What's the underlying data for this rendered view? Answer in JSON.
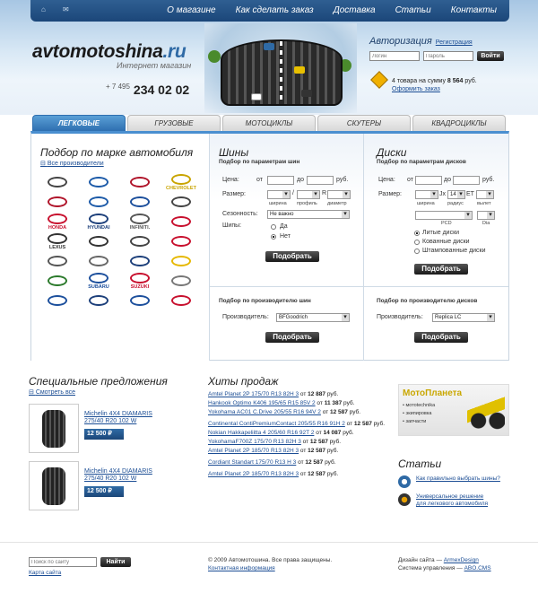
{
  "nav": {
    "items": [
      "О магазине",
      "Как сделать заказ",
      "Доставка",
      "Статьи",
      "Контакты"
    ]
  },
  "logo": {
    "name": "avtomotoshina",
    "tld": ".ru",
    "tagline": "Интернет магазин"
  },
  "phone": {
    "code": "+ 7 495",
    "number": "234 02 02"
  },
  "auth": {
    "title": "Авторизация",
    "register": "Регистрация",
    "login_placeholder": "Логин",
    "password_placeholder": "Пароль",
    "submit": "Войти"
  },
  "cart": {
    "text_pre": "4 товара на сумму",
    "sum": "8 564",
    "currency": "руб.",
    "order_link": "Оформить заказ"
  },
  "tabs": [
    "ЛЕГКОВЫЕ",
    "ГРУЗОВЫЕ",
    "МОТОЦИКЛЫ",
    "СКУТЕРЫ",
    "КВАДРОЦИКЛЫ"
  ],
  "brands": {
    "title": "Подбор по марке автомобиля",
    "all": "Все производители",
    "items": [
      {
        "label": "",
        "icon": "audi-logo",
        "color": "#444"
      },
      {
        "label": "",
        "icon": "bmw-logo",
        "color": "#1c5aa8"
      },
      {
        "label": "",
        "icon": "chery-logo",
        "color": "#b0142a"
      },
      {
        "label": "CHEVROLET",
        "icon": "chevrolet-logo",
        "color": "#c9a400"
      },
      {
        "label": "",
        "icon": "citroen-logo",
        "color": "#b0142a"
      },
      {
        "label": "",
        "icon": "daewoo-logo",
        "color": "#1c5aa8"
      },
      {
        "label": "",
        "icon": "ford-logo",
        "color": "#1c4f9c"
      },
      {
        "label": "",
        "icon": "infiniti-like-logo",
        "color": "#444"
      },
      {
        "label": "HONDA",
        "icon": "honda-logo",
        "color": "#c8102e"
      },
      {
        "label": "HYUNDAI",
        "icon": "hyundai-logo",
        "color": "#1c3f7a"
      },
      {
        "label": "INFINITI.",
        "icon": "infiniti-logo",
        "color": "#555"
      },
      {
        "label": "",
        "icon": "kia-logo",
        "color": "#c8102e"
      },
      {
        "label": "LEXUS",
        "icon": "lexus-logo",
        "color": "#333"
      },
      {
        "label": "",
        "icon": "mazda-logo",
        "color": "#333"
      },
      {
        "label": "",
        "icon": "mercedes-logo",
        "color": "#444"
      },
      {
        "label": "",
        "icon": "mitsubishi-logo",
        "color": "#c8102e"
      },
      {
        "label": "",
        "icon": "nissan-logo",
        "color": "#555"
      },
      {
        "label": "",
        "icon": "opel-logo",
        "color": "#666"
      },
      {
        "label": "",
        "icon": "peugeot-logo",
        "color": "#1c3f7a"
      },
      {
        "label": "",
        "icon": "renault-logo",
        "color": "#e6b800"
      },
      {
        "label": "",
        "icon": "skoda-logo",
        "color": "#2b7a2b"
      },
      {
        "label": "SUBARU",
        "icon": "subaru-logo",
        "color": "#1c4f9c"
      },
      {
        "label": "SUZUKI",
        "icon": "suzuki-logo",
        "color": "#c8102e"
      },
      {
        "label": "",
        "icon": "toyota-logo",
        "color": "#777"
      },
      {
        "label": "",
        "icon": "volkswagen-logo",
        "color": "#1c4f9c"
      },
      {
        "label": "",
        "icon": "volvo-logo",
        "color": "#1c3f7a"
      },
      {
        "label": "",
        "icon": "chevrolet-blue-logo",
        "color": "#1c4f9c"
      },
      {
        "label": "",
        "icon": "gaz-logo",
        "color": "#c8102e"
      }
    ]
  },
  "tires": {
    "title": "Шины",
    "sub": "Подбор по параметрам шин",
    "price_label": "Цена:",
    "from": "от",
    "to": "до",
    "currency": "руб.",
    "size_label": "Размер:",
    "slash": "/",
    "r": "R",
    "width": "ширина",
    "profile": "профиль",
    "diameter": "диаметр",
    "season_label": "Сезонность:",
    "season_value": "Не важно",
    "spikes_label": "Шипы:",
    "yes": "Да",
    "no": "Нет",
    "submit": "Подобрать",
    "maker_sub": "Подбор по производителю шин",
    "maker_label": "Производитель:",
    "maker_value": "BFGoodrich",
    "maker_submit": "Подобрать"
  },
  "discs": {
    "title": "Диски",
    "sub": "Подбор по параметрам дисков",
    "price_label": "Цена:",
    "from": "от",
    "to": "до",
    "currency": "руб.",
    "size_label": "Размер:",
    "jx": "Jx",
    "et": "ET",
    "width": "ширина",
    "radius": "радиус",
    "radius_value": "14",
    "offset": "вылет",
    "pcd": "PCD",
    "dia": "Dia",
    "opt1": "Литые диски",
    "opt2": "Кованные диски",
    "opt3": "Штампованные диски",
    "submit": "Подобрать",
    "maker_sub": "Подбор по производителю дисков",
    "maker_label": "Производитель:",
    "maker_value": "Replica LC",
    "maker_submit": "Подобрать"
  },
  "special": {
    "title": "Специальные предложения",
    "all": "Смотреть все",
    "items": [
      {
        "name": "Michelin 4X4 DIAMARIS 275/40 R20 102 W",
        "price": "12 500",
        "currency": "₽"
      },
      {
        "name": "Michelin 4X4 DIAMARIS 275/40 R20 102 W",
        "price": "12 500",
        "currency": "₽"
      }
    ]
  },
  "hits": {
    "title": "Хиты продаж",
    "items": [
      {
        "link": "Amtel Planet 2P 175/70 R13 82H 3",
        "from": "от",
        "price": "12 887",
        "cur": "руб."
      },
      {
        "link": "Hankook Optimo K406 195/65 R15 85V 2",
        "from": "от",
        "price": "11 387",
        "cur": "руб."
      },
      {
        "link": "Yokohama AC01 C.Drive 205/55 R16 94V 2",
        "from": "от",
        "price": "12 587",
        "cur": "руб."
      },
      {
        "link": "Continental ContiPremiumContact 205/55 R16 91H 2",
        "from": "от",
        "price": "12 587",
        "cur": "руб."
      },
      {
        "link": "Nokian Hakkapeliitta 4 205/60 R16 92T 2",
        "from": "от",
        "price": "14 087",
        "cur": "руб."
      },
      {
        "link": "YokohamaF700Z 175/70 R13 82H 3",
        "from": "от",
        "price": "12 587",
        "cur": "руб."
      },
      {
        "link": "Amtel Planet 2P 185/70 R13 82H 3",
        "from": "от",
        "price": "12 587",
        "cur": "руб."
      },
      {
        "link": "Cordiant Standart 175/70 R13 H 3",
        "from": "от",
        "price": "12 587",
        "cur": "руб."
      },
      {
        "link": "Amtel Planet 2P 185/70 R13 82H 3",
        "from": "от",
        "price": "12 587",
        "cur": "руб."
      }
    ]
  },
  "moto": {
    "brand_a": "Мото",
    "brand_b": "Планета",
    "l1": "мотоtechnika",
    "l2": "экипировка",
    "l3": "запчасти"
  },
  "articles": {
    "title": "Статьи",
    "items": [
      {
        "text": "Как правильно выбрать шины?",
        "icon": "question-icon"
      },
      {
        "text": "Универсальное решение\nдля легкового автомобиля",
        "icon": "wheel-icon"
      }
    ]
  },
  "footer": {
    "search_placeholder": "Поиск по сайту",
    "search_btn": "Найти",
    "sitemap": "Карта сайта",
    "copyright": "© 2009 Автомотошина. Все права защищены.",
    "contacts": "Контактная информация",
    "design_pre": "Дизайн сайта —",
    "design_link": "ArmexDesign",
    "cms_pre": "Система управления —",
    "cms_link": "ABO.CMS"
  }
}
